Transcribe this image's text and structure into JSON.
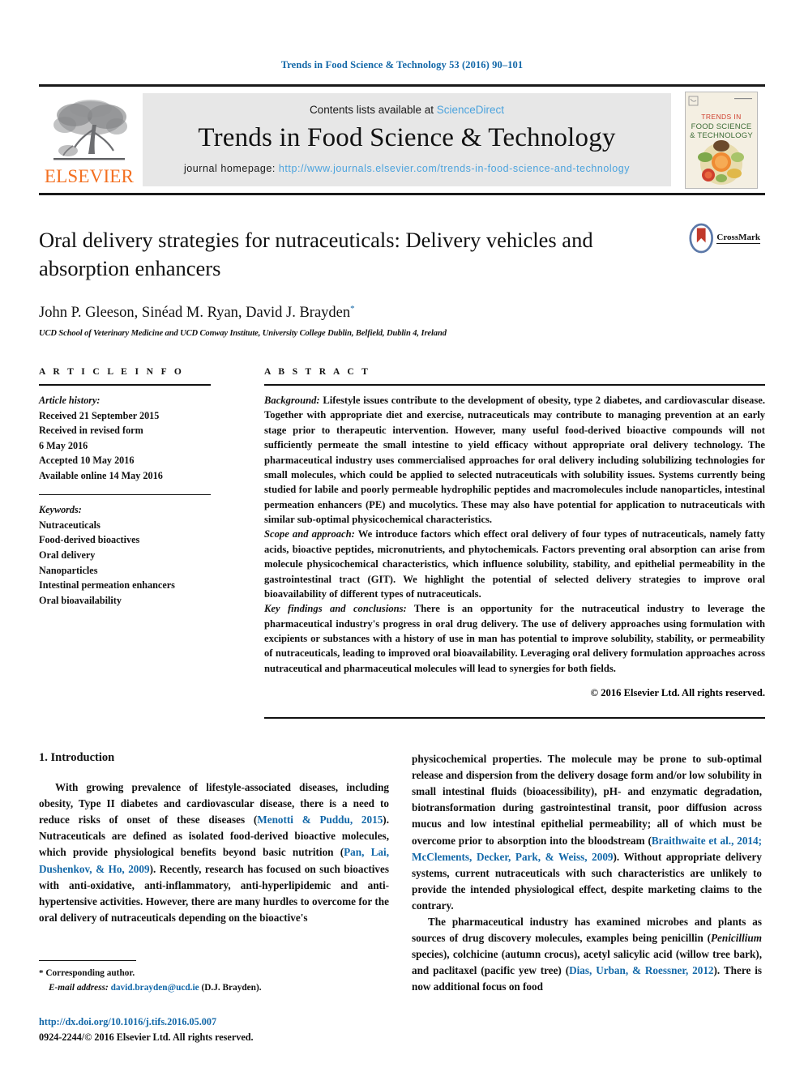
{
  "running_head": "Trends in Food Science & Technology 53 (2016) 90–101",
  "masthead": {
    "publisher_logo_label": "ELSEVIER",
    "contents_prefix": "Contents lists available at ",
    "contents_link": "ScienceDirect",
    "journal_title": "Trends in Food Science & Technology",
    "homepage_prefix": "journal homepage: ",
    "homepage_url": "http://www.journals.elsevier.com/trends-in-food-science-and-technology",
    "cover_caption": "TRENDS IN FOOD SCIENCE & TECHNOLOGY",
    "link_color": "#4ca3dd",
    "panel_color": "#e7e7e7"
  },
  "article": {
    "title": "Oral delivery strategies for nutraceuticals: Delivery vehicles and absorption enhancers",
    "authors": "John P. Gleeson, Sinéad M. Ryan, David J. Brayden",
    "corresponding_marker": "*",
    "affiliation": "UCD School of Veterinary Medicine and UCD Conway Institute, University College Dublin, Belfield, Dublin 4, Ireland",
    "crossmark_label": "CrossMark"
  },
  "article_info": {
    "heading": "A R T I C L E   I N F O",
    "history_label": "Article history:",
    "history": [
      "Received 21 September 2015",
      "Received in revised form",
      "6 May 2016",
      "Accepted 10 May 2016",
      "Available online 14 May 2016"
    ],
    "keywords_label": "Keywords:",
    "keywords": [
      "Nutraceuticals",
      "Food-derived bioactives",
      "Oral delivery",
      "Nanoparticles",
      "Intestinal permeation enhancers",
      "Oral bioavailability"
    ]
  },
  "abstract": {
    "heading": "A B S T R A C T",
    "background_label": "Background:",
    "background_text": " Lifestyle issues contribute to the development of obesity, type 2 diabetes, and cardiovascular disease. Together with appropriate diet and exercise, nutraceuticals may contribute to managing prevention at an early stage prior to therapeutic intervention. However, many useful food-derived bioactive compounds will not sufficiently permeate the small intestine to yield efficacy without appropriate oral delivery technology. The pharmaceutical industry uses commercialised approaches for oral delivery including solubilizing technologies for small molecules, which could be applied to selected nutraceuticals with solubility issues. Systems currently being studied for labile and poorly permeable hydrophilic peptides and macromolecules include nanoparticles, intestinal permeation enhancers (PE) and mucolytics. These may also have potential for application to nutraceuticals with similar sub-optimal physicochemical characteristics.",
    "scope_label": "Scope and approach:",
    "scope_text": " We introduce factors which effect oral delivery of four types of nutraceuticals, namely fatty acids, bioactive peptides, micronutrients, and phytochemicals. Factors preventing oral absorption can arise from molecule physicochemical characteristics, which influence solubility, stability, and epithelial permeability in the gastrointestinal tract (GIT). We highlight the potential of selected delivery strategies to improve oral bioavailability of different types of nutraceuticals.",
    "findings_label": "Key findings and conclusions:",
    "findings_text": " There is an opportunity for the nutraceutical industry to leverage the pharmaceutical industry's progress in oral drug delivery. The use of delivery approaches using formulation with excipients or substances with a history of use in man has potential to improve solubility, stability, or permeability of nutraceuticals, leading to improved oral bioavailability. Leveraging oral delivery formulation approaches across nutraceutical and pharmaceutical molecules will lead to synergies for both fields.",
    "copyright": "© 2016 Elsevier Ltd. All rights reserved."
  },
  "introduction": {
    "section_number_title": "1. Introduction",
    "left_p1_a": "With growing prevalence of lifestyle-associated diseases, including obesity, Type II diabetes and cardiovascular disease, there is a need to reduce risks of onset of these diseases (",
    "left_p1_ref1": "Menotti & Puddu, 2015",
    "left_p1_b": "). Nutraceuticals are defined as isolated food-derived bioactive molecules, which provide physiological benefits beyond basic nutrition (",
    "left_p1_ref2": "Pan, Lai, Dushenkov, & Ho, 2009",
    "left_p1_c": "). Recently, research has focused on such bioactives with anti-oxidative, anti-inflammatory, anti-hyperlipidemic and anti-hypertensive activities. However, there are many hurdles to overcome for the oral delivery of nutraceuticals depending on the bioactive's",
    "right_p1_a": "physicochemical properties. The molecule may be prone to sub-optimal release and dispersion from the delivery dosage form and/or low solubility in small intestinal fluids (bioacessibility), pH- and enzymatic degradation, biotransformation during gastrointestinal transit, poor diffusion across mucus and low intestinal epithelial permeability; all of which must be overcome prior to absorption into the bloodstream (",
    "right_p1_ref1": "Braithwaite et al., 2014; McClements, Decker, Park, & Weiss, 2009",
    "right_p1_b": "). Without appropriate delivery systems, current nutraceuticals with such characteristics are unlikely to provide the intended physiological effect, despite marketing claims to the contrary.",
    "right_p2_a": "The pharmaceutical industry has examined microbes and plants as sources of drug discovery molecules, examples being penicillin (",
    "right_p2_ital": "Penicillium",
    "right_p2_b": " species), colchicine (autumn crocus), acetyl salicylic acid (willow tree bark), and paclitaxel (pacific yew tree) (",
    "right_p2_ref1": "Dias, Urban, & Roessner, 2012",
    "right_p2_c": "). There is now additional focus on food"
  },
  "footnote": {
    "star": "*",
    "corresponding": " Corresponding author.",
    "email_label": "E-mail address:",
    "email": "david.brayden@ucd.ie",
    "email_suffix": " (D.J. Brayden)."
  },
  "page_footer": {
    "doi": "http://dx.doi.org/10.1016/j.tifs.2016.05.007",
    "issn_copyright": "0924-2244/© 2016 Elsevier Ltd. All rights reserved."
  },
  "colors": {
    "link_blue": "#1368a8",
    "elsevier_orange": "#f37021",
    "light_blue": "#4ca3dd"
  }
}
